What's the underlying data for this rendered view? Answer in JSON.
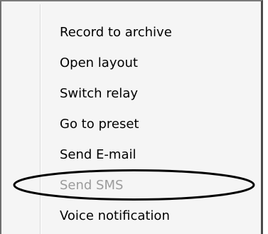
{
  "menu": {
    "items": [
      {
        "label": "Record to archive",
        "enabled": true
      },
      {
        "label": "Open layout",
        "enabled": true
      },
      {
        "label": "Switch relay",
        "enabled": true
      },
      {
        "label": "Go to preset",
        "enabled": true
      },
      {
        "label": "Send E-mail",
        "enabled": true
      },
      {
        "label": "Send SMS",
        "enabled": false
      },
      {
        "label": "Voice notification",
        "enabled": true
      }
    ]
  },
  "annotation": {
    "target": "Send SMS",
    "color": "#000000"
  },
  "colors": {
    "menu_background": "#f5f5f5",
    "text": "#000000",
    "disabled_text": "#9b9b9b",
    "frame": "#4a4a4a"
  }
}
